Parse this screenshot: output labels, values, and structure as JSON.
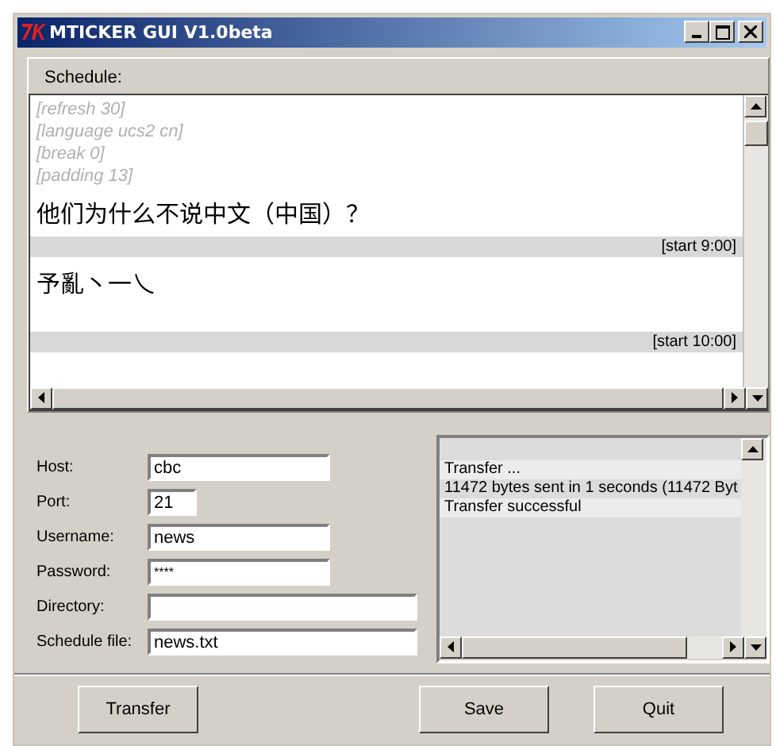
{
  "window": {
    "title": "MTICKER GUI V1.0beta"
  },
  "schedule": {
    "label": "Schedule:",
    "lines": [
      {
        "kind": "directive",
        "text": "[refresh 30]"
      },
      {
        "kind": "directive",
        "text": "[language ucs2 cn]"
      },
      {
        "kind": "directive",
        "text": "[break 0]"
      },
      {
        "kind": "directive",
        "text": "[padding 13]"
      },
      {
        "kind": "text",
        "text": "他们为什么不说中文（中国）？"
      },
      {
        "kind": "marker",
        "text": "[start 9:00]"
      },
      {
        "kind": "text",
        "text": "予亂丶一乀"
      },
      {
        "kind": "blank"
      },
      {
        "kind": "marker",
        "text": "[start 10:00]"
      }
    ]
  },
  "form": [
    {
      "label": "Host:",
      "value": "cbc"
    },
    {
      "label": "Port:",
      "value": "21"
    },
    {
      "label": "Username:",
      "value": "news"
    },
    {
      "label": "Password:",
      "value": "****"
    },
    {
      "label": "Directory:"
    },
    {
      "label": "Schedule file:",
      "value": "news.txt"
    }
  ],
  "log": [
    {
      "text": "Transfer ...",
      "highlighted": true
    },
    {
      "text": "11472 bytes sent in 1 seconds (11472 Byt",
      "highlighted": false
    },
    {
      "text": "Transfer successful",
      "highlighted": true
    }
  ],
  "buttons": [
    "Transfer",
    "Save",
    "Quit"
  ]
}
